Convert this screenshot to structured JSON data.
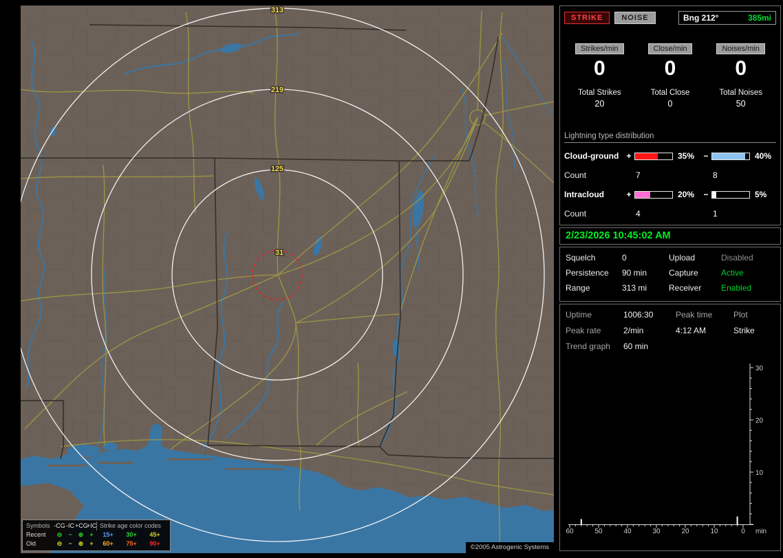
{
  "map": {
    "ring_labels": [
      "313",
      "219",
      "125",
      "31"
    ],
    "legend": {
      "symbols_header": "Symbols",
      "symbol_cols": [
        "-CG",
        "-IC",
        "+CG",
        "+IC"
      ],
      "icons": [
        "⊖",
        "−",
        "⊕",
        "+"
      ],
      "age_header": "Strike age color codes",
      "recent_label": "Recent",
      "old_label": "Old",
      "recent_color": "#2ecc2e",
      "old_color": "#d6d62a",
      "recent_ages": [
        {
          "label": "15+",
          "color": "#5b9bff"
        },
        {
          "label": "30+",
          "color": "#35d435"
        },
        {
          "label": "45+",
          "color": "#d2d22e"
        }
      ],
      "old_ages": [
        {
          "label": "60+",
          "color": "#ffb020"
        },
        {
          "label": "75+",
          "color": "#ff6a1a"
        },
        {
          "label": "90+",
          "color": "#ff2a2a"
        }
      ]
    },
    "copyright": "©2005 Astrogenic Systems"
  },
  "panel": {
    "strike_button": "STRIKE",
    "noise_button": "NOISE",
    "bearing": {
      "label": "Bng 212°",
      "range": "385mi",
      "range_color": "#00e035"
    },
    "counters": [
      {
        "label": "Strikes/min",
        "value": "0",
        "total_label": "Total Strikes",
        "total_value": "20"
      },
      {
        "label": "Close/min",
        "value": "0",
        "total_label": "Total Close",
        "total_value": "0"
      },
      {
        "label": "Noises/min",
        "value": "0",
        "total_label": "Total Noises",
        "total_value": "50"
      }
    ],
    "distribution": {
      "header": "Lightning type distribution",
      "count_label": "Count",
      "rows": [
        {
          "name": "Cloud-ground",
          "plus_sign": "+",
          "minus_sign": "−",
          "plus_pct": "35%",
          "minus_pct": "40%",
          "plus_fill": "62%",
          "minus_fill": "88%",
          "plus_color": "#ff1414",
          "minus_color": "#8fc3ef",
          "plus_count": "7",
          "minus_count": "8"
        },
        {
          "name": "Intracloud",
          "plus_sign": "+",
          "minus_sign": "−",
          "plus_pct": "20%",
          "minus_pct": "5%",
          "plus_fill": "40%",
          "minus_fill": "12%",
          "plus_color": "#ff6ed2",
          "minus_color": "#ffffff",
          "plus_count": "4",
          "minus_count": "1"
        }
      ]
    },
    "datetime": "2/23/2026 10:45:02 AM",
    "settings": [
      {
        "label_left": "Squelch",
        "value_left": "0",
        "label_right": "Upload",
        "value_right": "Disabled",
        "value_right_color": "#8f8f8f"
      },
      {
        "label_left": "Persistence",
        "value_left": "90 min",
        "label_right": "Capture",
        "value_right": "Active",
        "value_right_color": "#00d42a"
      },
      {
        "label_left": "Range",
        "value_left": "313 mi",
        "label_right": "Receiver",
        "value_right": "Enabled",
        "value_right_color": "#00d42a"
      }
    ],
    "status": {
      "uptime_label": "Uptime",
      "uptime_value": "1006:30",
      "peak_time_label": "Peak time",
      "plot_label": "Plot",
      "peak_rate_label": "Peak rate",
      "peak_rate_value": "2/min",
      "peak_time_value": "4:12 AM",
      "plot_value": "Strike",
      "trend_label": "Trend graph",
      "trend_value": "60 min"
    }
  },
  "chart_data": {
    "type": "bar",
    "title": "Strike trend graph (last 60 min)",
    "x_ticks": [
      60,
      50,
      40,
      30,
      20,
      10,
      0
    ],
    "y_ticks": [
      10,
      20,
      30
    ],
    "ylim": [
      0,
      32
    ],
    "x_unit_label": "min",
    "legend_position": "none",
    "spikes": [
      {
        "minutes_ago": 56,
        "value": 1
      },
      {
        "minutes_ago": 2,
        "value": 1.5
      }
    ]
  }
}
